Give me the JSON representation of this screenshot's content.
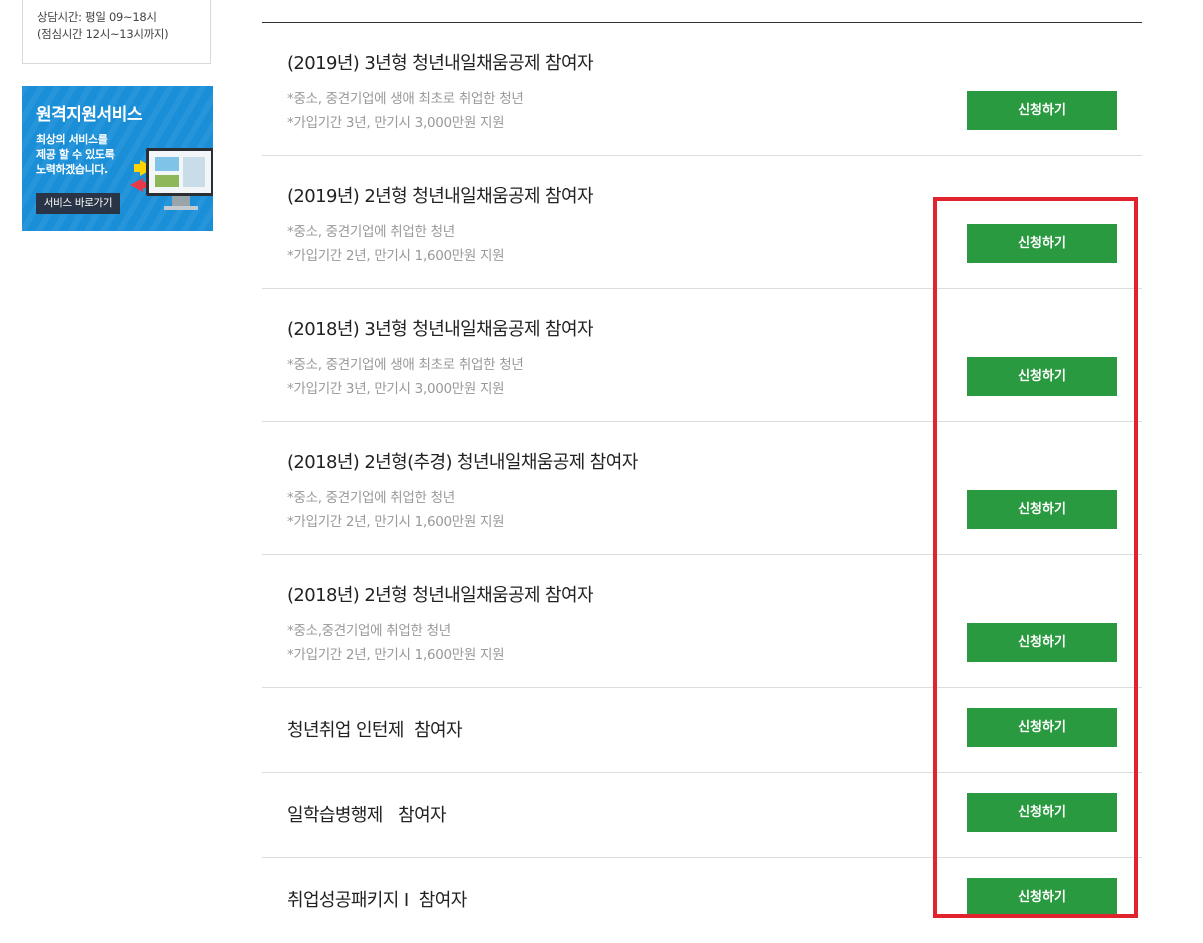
{
  "sidebar": {
    "hours": {
      "line1": "상담시간: 평일 09~18시",
      "line2": "(점심시간 12시~13시까지)"
    },
    "banner": {
      "title": "원격지원서비스",
      "desc_line1": "최상의 서비스를",
      "desc_line2": "제공 할 수 있도록",
      "desc_line3": "노력하겠습니다.",
      "button_label": "서비스 바로가기",
      "color": "#1a8fd8"
    }
  },
  "list": {
    "button_color": "#2a9a40",
    "items": [
      {
        "title": "(2019년) 3년형 청년내일채움공제 참여자",
        "desc": [
          "*중소, 중견기업에 생애 최초로 취업한 청년",
          "*가입기간 3년, 만기시 3,000만원 지원"
        ],
        "button": "신청하기"
      },
      {
        "title": "(2019년) 2년형 청년내일채움공제 참여자",
        "desc": [
          "*중소, 중견기업에 취업한 청년",
          "*가입기간 2년, 만기시 1,600만원 지원"
        ],
        "button": "신청하기"
      },
      {
        "title": "(2018년) 3년형 청년내일채움공제 참여자",
        "desc": [
          "*중소, 중견기업에 생애 최초로 취업한 청년",
          "*가입기간 3년, 만기시 3,000만원 지원"
        ],
        "button": "신청하기"
      },
      {
        "title": "(2018년) 2년형(추경) 청년내일채움공제 참여자",
        "desc": [
          "*중소, 중견기업에 취업한 청년",
          "*가입기간 2년, 만기시 1,600만원 지원"
        ],
        "button": "신청하기"
      },
      {
        "title": "(2018년) 2년형 청년내일채움공제 참여자",
        "desc": [
          "*중소,중견기업에 취업한 청년",
          "*가입기간 2년, 만기시 1,600만원 지원"
        ],
        "button": "신청하기"
      },
      {
        "title": "청년취업 인턴제  참여자",
        "desc": [],
        "button": "신청하기"
      },
      {
        "title": "일학습병행제   참여자",
        "desc": [],
        "button": "신청하기"
      },
      {
        "title": "취업성공패키지 I  참여자",
        "desc": [],
        "button": "신청하기"
      }
    ]
  },
  "highlight_color": "#e0232d"
}
